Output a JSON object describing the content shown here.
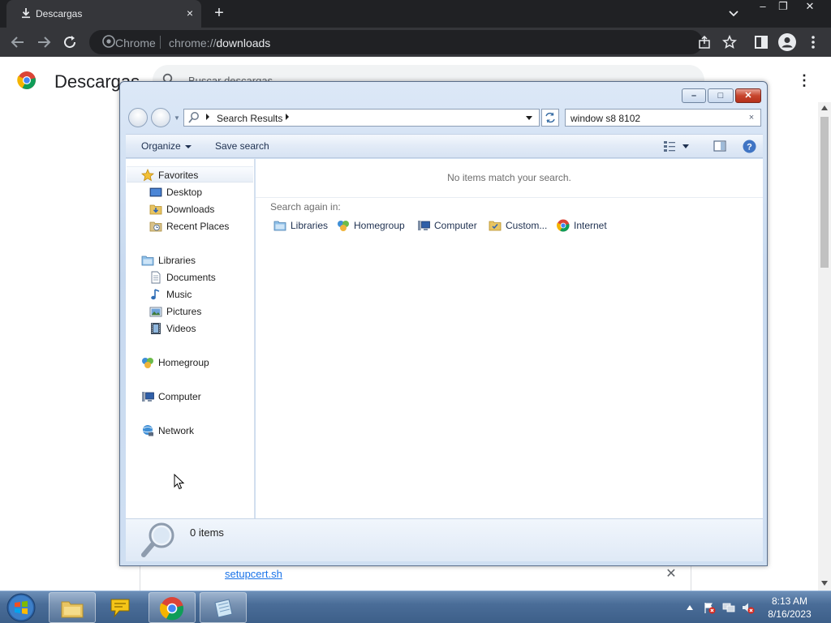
{
  "chrome": {
    "tab": {
      "title": "Descargas",
      "close_icon": "×",
      "newtab_icon": "+"
    },
    "window_controls": {
      "minimize": "–",
      "restore": "❐",
      "close": "✕"
    },
    "omnibox": {
      "site_label": "Chrome",
      "url_prefix": "chrome://",
      "url_host": "downloads"
    },
    "header": {
      "title": "Descargas",
      "search_placeholder": "Buscar descargas",
      "menu_icon": "⋮"
    },
    "download": {
      "filename": "setupcert.sh",
      "remove_icon": "✕"
    }
  },
  "explorer": {
    "caption": {
      "minimize": "–",
      "maximize": "□",
      "close": "✕"
    },
    "address": {
      "crumb": "Search Results"
    },
    "search": {
      "value": "window s8 8102",
      "clear_icon": "×"
    },
    "commands": {
      "organize": "Organize",
      "save_search": "Save search"
    },
    "nav": {
      "favorites": {
        "label": "Favorites",
        "items": [
          "Desktop",
          "Downloads",
          "Recent Places"
        ]
      },
      "libraries": {
        "label": "Libraries",
        "items": [
          "Documents",
          "Music",
          "Pictures",
          "Videos"
        ]
      },
      "homegroup": "Homegroup",
      "computer": "Computer",
      "network": "Network"
    },
    "content": {
      "empty_message": "No items match your search.",
      "search_again_label": "Search again in:",
      "search_again_items": [
        "Libraries",
        "Homegroup",
        "Computer",
        "Custom...",
        "Internet"
      ]
    },
    "details": {
      "count": "0 items"
    }
  },
  "taskbar": {
    "clock": {
      "time": "8:13 AM",
      "date": "8/16/2023"
    }
  }
}
